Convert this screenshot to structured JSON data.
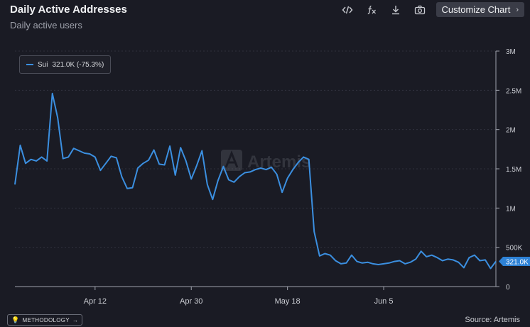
{
  "header": {
    "title": "Daily Active Addresses",
    "subtitle": "Daily active users",
    "customize_label": "Customize Chart",
    "tools": [
      "code-icon",
      "formula-icon",
      "download-icon",
      "camera-icon"
    ]
  },
  "legend": {
    "series_name": "Sui",
    "value_text": "321.0K (-75.3%)"
  },
  "watermark": "Artemis",
  "footer": {
    "methodology_label": "METHODOLOGY",
    "source": "Source: Artemis"
  },
  "colors": {
    "background": "#1a1b24",
    "line": "#3b8fe0",
    "grid": "#30323d"
  },
  "chart_data": {
    "type": "line",
    "title": "Daily Active Addresses",
    "subtitle": "Daily active users",
    "xlabel": "",
    "ylabel": "",
    "ylim": [
      0,
      3000000
    ],
    "x_ticks": [
      "Apr 12",
      "Apr 30",
      "May 18",
      "Jun 5"
    ],
    "x_tick_index": [
      15,
      33,
      51,
      69
    ],
    "y_ticks": [
      "0",
      "500K",
      "1M",
      "1.5M",
      "2M",
      "2.5M",
      "3M"
    ],
    "y_tick_values": [
      0,
      500000,
      1000000,
      1500000,
      2000000,
      2500000,
      3000000
    ],
    "last_value_label": "321.0K",
    "grid": "horizontal",
    "legend_position": "top-left",
    "series": [
      {
        "name": "Sui",
        "color": "#3b8fe0",
        "values": [
          1300000,
          1800000,
          1570000,
          1620000,
          1600000,
          1650000,
          1600000,
          2460000,
          2150000,
          1630000,
          1650000,
          1760000,
          1730000,
          1700000,
          1690000,
          1650000,
          1480000,
          1570000,
          1660000,
          1640000,
          1400000,
          1250000,
          1260000,
          1510000,
          1570000,
          1610000,
          1740000,
          1560000,
          1550000,
          1790000,
          1420000,
          1770000,
          1600000,
          1370000,
          1540000,
          1730000,
          1300000,
          1110000,
          1350000,
          1530000,
          1360000,
          1330000,
          1400000,
          1450000,
          1460000,
          1490000,
          1510000,
          1490000,
          1520000,
          1430000,
          1200000,
          1380000,
          1490000,
          1580000,
          1650000,
          1620000,
          700000,
          390000,
          420000,
          400000,
          330000,
          290000,
          300000,
          400000,
          320000,
          300000,
          310000,
          290000,
          280000,
          290000,
          300000,
          320000,
          330000,
          290000,
          310000,
          350000,
          450000,
          380000,
          400000,
          370000,
          330000,
          350000,
          340000,
          310000,
          240000,
          370000,
          400000,
          330000,
          340000,
          230000,
          321000
        ]
      }
    ]
  }
}
